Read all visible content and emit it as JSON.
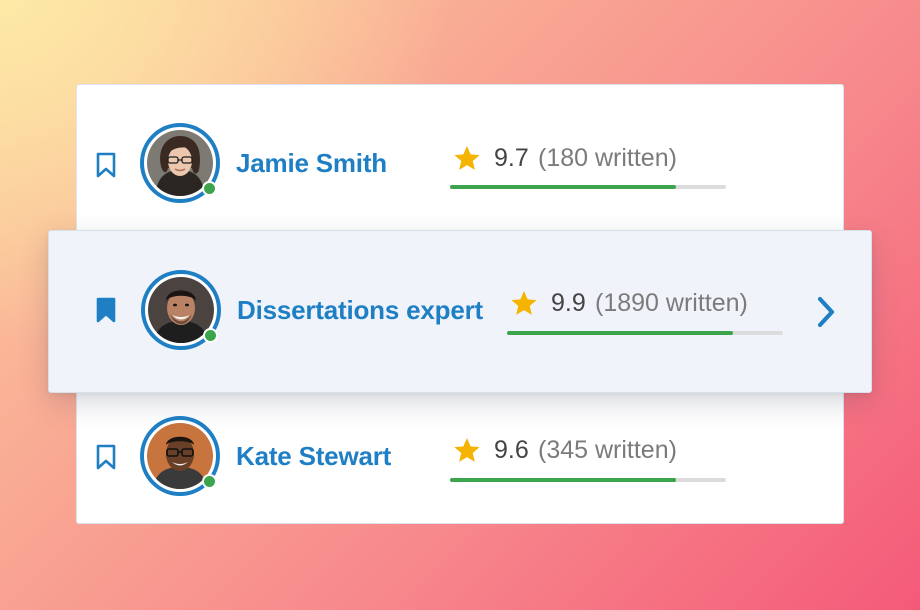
{
  "writers": [
    {
      "name": "Jamie Smith",
      "rating": "9.7",
      "written": "(180 written)",
      "progress": 0.82,
      "bookmarked": false,
      "online": true,
      "avatar": "woman-with-glasses"
    },
    {
      "name": "Dissertations expert",
      "rating": "9.9",
      "written": "(1890 written)",
      "progress": 0.82,
      "bookmarked": true,
      "online": true,
      "avatar": "smiling-man",
      "selected": true
    },
    {
      "name": "Kate Stewart",
      "rating": "9.6",
      "written": "(345 written)",
      "progress": 0.82,
      "bookmarked": false,
      "online": true,
      "avatar": "man-with-glasses"
    }
  ],
  "icons": {
    "bookmark": "bookmark-icon",
    "star": "star-icon",
    "chevron": "chevron-right-icon"
  },
  "colors": {
    "accent": "#1f7fc4",
    "star": "#f5b400",
    "online": "#3ca44c",
    "progress": "#3ca44c"
  }
}
